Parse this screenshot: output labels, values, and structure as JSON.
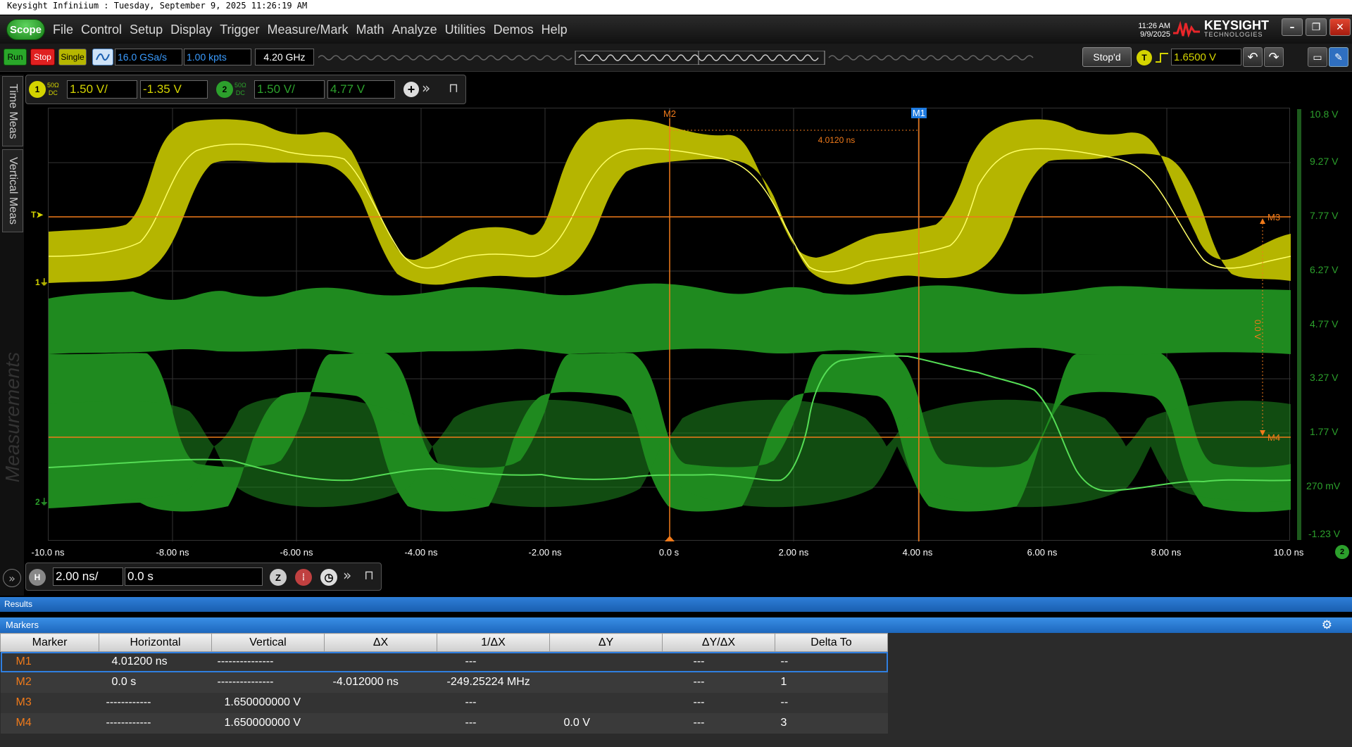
{
  "window": {
    "title": "Keysight Infiniium : Tuesday, September 9, 2025 11:26:19 AM",
    "time": "11:26 AM",
    "date": "9/9/2025",
    "brand": "KEYSIGHT",
    "brand_sub": "TECHNOLOGIES"
  },
  "menu": {
    "scope": "Scope",
    "items": [
      "File",
      "Control",
      "Setup",
      "Display",
      "Trigger",
      "Measure/Mark",
      "Math",
      "Analyze",
      "Utilities",
      "Demos",
      "Help"
    ]
  },
  "toolbar": {
    "run": "Run",
    "stop": "Stop",
    "single": "Single",
    "sample_rate": "16.0 GSa/s",
    "memory": "1.00 kpts",
    "bandwidth": "4.20 GHz",
    "status": "Stop'd",
    "trigger_source": "T",
    "trigger_level": "1.6500 V"
  },
  "channels": {
    "ch1": {
      "number": "1",
      "coupling_top": "50Ω",
      "coupling_bottom": "DC",
      "scale": "1.50 V/",
      "offset": "-1.35 V",
      "color": "#d4d400"
    },
    "ch2": {
      "number": "2",
      "coupling_top": "50Ω",
      "coupling_bottom": "DC",
      "scale": "1.50 V/",
      "offset": "4.77 V",
      "color": "#2ca02c"
    }
  },
  "side_tabs": [
    "Time Meas",
    "Vertical Meas"
  ],
  "side_watermark": "Measurements",
  "plot": {
    "trigger_marker": "T",
    "ch1_ground": "1",
    "ch2_ground": "2",
    "marker_labels": {
      "m1": "M1",
      "m2": "M2",
      "m3": "M3",
      "m4": "M4"
    },
    "dx_annotation": "4.0120 ns",
    "dy_annotation": "0.0 V",
    "x_ticks": [
      "-10.0 ns",
      "-8.00 ns",
      "-6.00 ns",
      "-4.00 ns",
      "-2.00 ns",
      "0.0 s",
      "2.00 ns",
      "4.00 ns",
      "6.00 ns",
      "8.00 ns",
      "10.0 ns"
    ],
    "y_ticks": [
      "10.8 V",
      "9.27 V",
      "7.77 V",
      "6.27 V",
      "4.77 V",
      "3.27 V",
      "1.77 V",
      "270 mV",
      "-1.23 V"
    ],
    "ch2_badge": "2",
    "x_range_ns": [
      -10,
      10
    ],
    "m1_ns": 4.012,
    "m2_ns": 0
  },
  "horizontal": {
    "label": "H",
    "scale": "2.00 ns/",
    "delay": "0.0 s"
  },
  "results": {
    "title": "Results",
    "markers_title": "Markers",
    "columns": [
      "Marker",
      "Horizontal",
      "Vertical",
      "ΔX",
      "1/ΔX",
      "ΔY",
      "ΔY/ΔX",
      "Delta To"
    ],
    "rows": [
      [
        "M1",
        "4.01200 ns",
        "---------------",
        "",
        "---",
        "",
        "---",
        "--"
      ],
      [
        "M2",
        "0.0 s",
        "---------------",
        "-4.012000 ns",
        "-249.25224 MHz",
        "",
        "---",
        "1"
      ],
      [
        "M3",
        "------------",
        "1.650000000 V",
        "",
        "---",
        "",
        "---",
        "--"
      ],
      [
        "M4",
        "------------",
        "1.650000000 V",
        "",
        "---",
        "0.0 V",
        "---",
        "3"
      ]
    ]
  }
}
